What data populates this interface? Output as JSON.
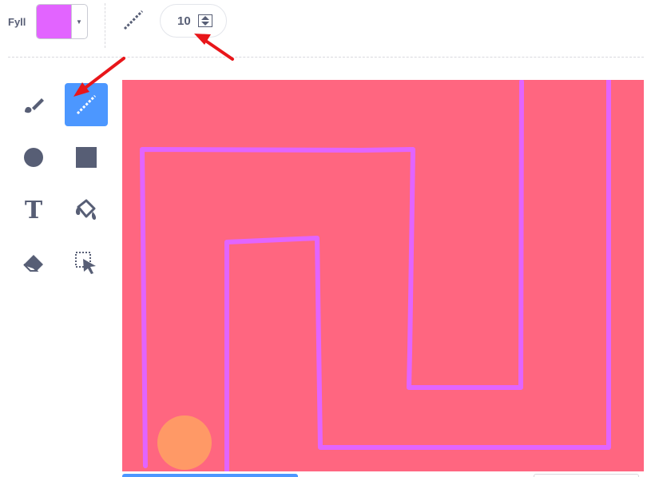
{
  "toolbar": {
    "fill_label": "Fyll",
    "fill_color": "#e264ff",
    "dropdown_icon": "triangle-down",
    "outline_icon": "line-width-icon",
    "brush_size_value": "10",
    "stepper_icon": "up-down-stepper"
  },
  "tools": [
    {
      "name": "brush-tool",
      "icon": "brush-icon",
      "active": false
    },
    {
      "name": "line-tool",
      "icon": "line-icon",
      "active": true
    },
    {
      "name": "circle-tool",
      "icon": "circle-icon",
      "active": false
    },
    {
      "name": "rectangle-tool",
      "icon": "rectangle-icon",
      "active": false
    },
    {
      "name": "text-tool",
      "icon": "text-icon",
      "glyph": "T",
      "active": false
    },
    {
      "name": "fill-tool",
      "icon": "paint-bucket-icon",
      "active": false
    },
    {
      "name": "eraser-tool",
      "icon": "eraser-icon",
      "active": false
    },
    {
      "name": "select-tool",
      "icon": "select-icon",
      "active": false
    }
  ],
  "canvas": {
    "background_color": "#ff6680",
    "line_color": "#e264ff",
    "ball_color": "#ff9966"
  },
  "colors": {
    "accent": "#4c97ff",
    "annotation_arrow": "#e8161a",
    "icon_gray": "#575e75"
  }
}
